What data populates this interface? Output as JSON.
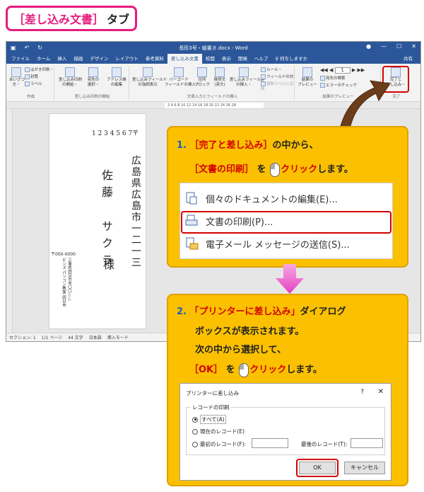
{
  "header": {
    "bracket_open": "［",
    "title": "差し込み文書",
    "bracket_close": "］",
    "tab_suffix": "タブ"
  },
  "word": {
    "doc_title": "長形3号・縦書き.docx - Word",
    "tabs": [
      "ファイル",
      "ホーム",
      "挿入",
      "描画",
      "デザイン",
      "レイアウト",
      "参考資料",
      "差し込み文書",
      "校閲",
      "表示",
      "開発",
      "ヘルプ",
      "♀ 何をしますか",
      "共有"
    ],
    "active_tab": "差し込み文書",
    "ribbon": {
      "g1": {
        "b1": "あいさつ\n文・",
        "b2": "はがき印刷・",
        "b3": "封筒",
        "b4": "ラベル",
        "label": "作成"
      },
      "g2": {
        "b1": "差し込み印刷\nの開始・",
        "b2": "宛先の\n選択・",
        "b3": "アドレス帳\nの編集",
        "label": "差し込み印刷の開始"
      },
      "g3": {
        "b1": "差し込みフィールド\nの強調表示",
        "b2": "バーコード\nフィールドの挿入・",
        "b3": "住所\nブロック",
        "b4": "挨拶文\n(英文)",
        "b5": "差し込みフィールド\nの挿入・",
        "b6": "ルール・",
        "b7": "フィールドの対応",
        "b8": "複数ラベルに反映",
        "label": "文章入力とフィールドの挿入"
      },
      "g4": {
        "b1": "結果の\nプレビュー",
        "nav": "1",
        "b2": "宛先の検索",
        "b3": "エラーのチェック",
        "label": "結果のプレビュー"
      },
      "g5": {
        "b1": "完了と\n差し込み・",
        "label": "完了"
      }
    },
    "ruler": "2  4  6  8  10  12  14  16  18  20  22  24  26  28",
    "page": {
      "zip": "1 2 3 4 5 6 7〒",
      "address": "広島県広島市一二一三",
      "name": "佐藤　サクラ",
      "honorific": "様",
      "sender_zip": "〒000-0000",
      "sender_lines": [
        "三重県四日市市〇〇△△",
        "ビンズ パソコン教室 四日市"
      ]
    },
    "status": [
      "セクション: 1",
      "1/1 ページ",
      "44 文字",
      "日本語",
      "挿入モード"
    ]
  },
  "callout1": {
    "num": "1.",
    "l1_a": "［完了と差し込み］",
    "l1_b": "の中から、",
    "l2_a": "［文書の印刷］",
    "l2_b": "を",
    "l2_c": "クリック",
    "l2_d": "します。",
    "menu": [
      "個々のドキュメントの編集(E)...",
      "文書の印刷(P)...",
      "電子メール メッセージの送信(S)..."
    ]
  },
  "callout2": {
    "num": "2.",
    "l1_a": "「プリンターに差し込み」",
    "l1_b": "ダイアログ",
    "l2": "ボックスが表示されます。",
    "l3": "次の中から選択して、",
    "l4_a": "［OK］",
    "l4_b": "を",
    "l4_c": "クリック",
    "l4_d": "します。"
  },
  "dialog": {
    "title": "プリンターに差し込み",
    "help": "?",
    "close": "✕",
    "group": "レコードの印刷",
    "opt_all": "すべて(A)",
    "opt_current": "現在のレコード(E)",
    "opt_from": "最初のレコード(F):",
    "to_label": "最後のレコード(T):",
    "ok": "OK",
    "cancel": "キャンセル"
  },
  "colors": {
    "accent": "#e61b7e",
    "word_blue": "#2b579a",
    "callout": "#fbc100",
    "highlight": "#d40000"
  }
}
